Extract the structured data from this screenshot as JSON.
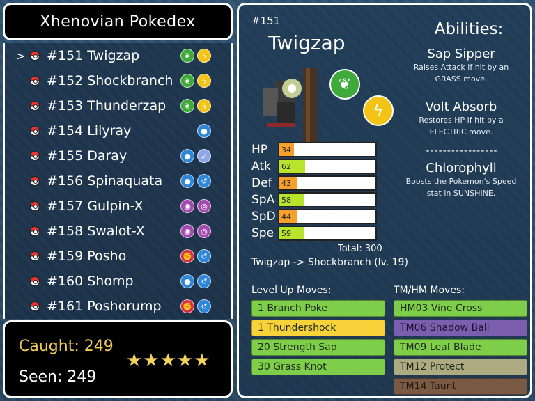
{
  "title": "Xhenovian Pokedex",
  "list": [
    {
      "label": "#151 Twigzap",
      "selected": true,
      "types": [
        "grass",
        "electric"
      ]
    },
    {
      "label": "#152 Shockbranch",
      "selected": false,
      "types": [
        "grass",
        "electric"
      ]
    },
    {
      "label": "#153 Thunderzap",
      "selected": false,
      "types": [
        "grass",
        "electric"
      ]
    },
    {
      "label": "#154 Lilyray",
      "selected": false,
      "types": [
        "water"
      ]
    },
    {
      "label": "#155 Daray",
      "selected": false,
      "types": [
        "water",
        "flying"
      ]
    },
    {
      "label": "#156 Spinaquata",
      "selected": false,
      "types": [
        "water",
        "water2"
      ]
    },
    {
      "label": "#157 Gulpin-X",
      "selected": false,
      "types": [
        "poison",
        "poison2"
      ]
    },
    {
      "label": "#158 Swalot-X",
      "selected": false,
      "types": [
        "poison",
        "poison2"
      ]
    },
    {
      "label": "#159 Posho",
      "selected": false,
      "types": [
        "fighting",
        "water2"
      ]
    },
    {
      "label": "#160 Shomp",
      "selected": false,
      "types": [
        "water",
        "water2"
      ]
    },
    {
      "label": "#161 Poshorump",
      "selected": false,
      "types": [
        "fighting",
        "water2"
      ]
    }
  ],
  "cursor": ">",
  "counts": {
    "caught_label": "Caught:",
    "caught": "249",
    "seen_label": "Seen:",
    "seen": "249",
    "stars": "★★★★★"
  },
  "detail": {
    "number": "#151",
    "name": "Twigzap",
    "abilities_title": "Abilities:",
    "abilities": [
      {
        "name": "Sap Sipper",
        "desc1": "Raises Attack if hit by an",
        "desc2": "GRASS move."
      },
      {
        "name": "Volt Absorb",
        "desc1": "Restores HP if hit by a",
        "desc2": "ELECTRIC move."
      }
    ],
    "divider": "-----------------",
    "hidden_ability": {
      "name": "Chlorophyll",
      "desc1": "Boosts the Pokemon's Speed",
      "desc2": "stat in SUNSHINE."
    },
    "stats": [
      {
        "label": "HP",
        "value": "34",
        "num": 34,
        "color": "#f7a02c"
      },
      {
        "label": "Atk",
        "value": "62",
        "num": 62,
        "color": "#b8e52c"
      },
      {
        "label": "Def",
        "value": "43",
        "num": 43,
        "color": "#f7a02c"
      },
      {
        "label": "SpA",
        "value": "58",
        "num": 58,
        "color": "#b8e52c"
      },
      {
        "label": "SpD",
        "value": "44",
        "num": 44,
        "color": "#f7a02c"
      },
      {
        "label": "Spe",
        "value": "59",
        "num": 59,
        "color": "#b8e52c"
      }
    ],
    "total": "Total: 300",
    "evolution": "Twigzap -> Shockbranch (lv. 19)",
    "levelup_header": "Level Up Moves:",
    "tm_header": "TM/HM Moves:",
    "levelup_moves": [
      {
        "label": "1 Branch Poke",
        "type": "grass"
      },
      {
        "label": "1 Thundershock",
        "type": "electric"
      },
      {
        "label": "20 Strength Sap",
        "type": "grass"
      },
      {
        "label": "30 Grass Knot",
        "type": "grass"
      }
    ],
    "tm_moves": [
      {
        "label": "HM03 Vine Cross",
        "type": "grass"
      },
      {
        "label": "TM06 Shadow Ball",
        "type": "ghost"
      },
      {
        "label": "TM09 Leaf Blade",
        "type": "grass"
      },
      {
        "label": "TM12 Protect",
        "type": "normal"
      },
      {
        "label": "TM14 Taunt",
        "type": "taunt"
      }
    ]
  }
}
